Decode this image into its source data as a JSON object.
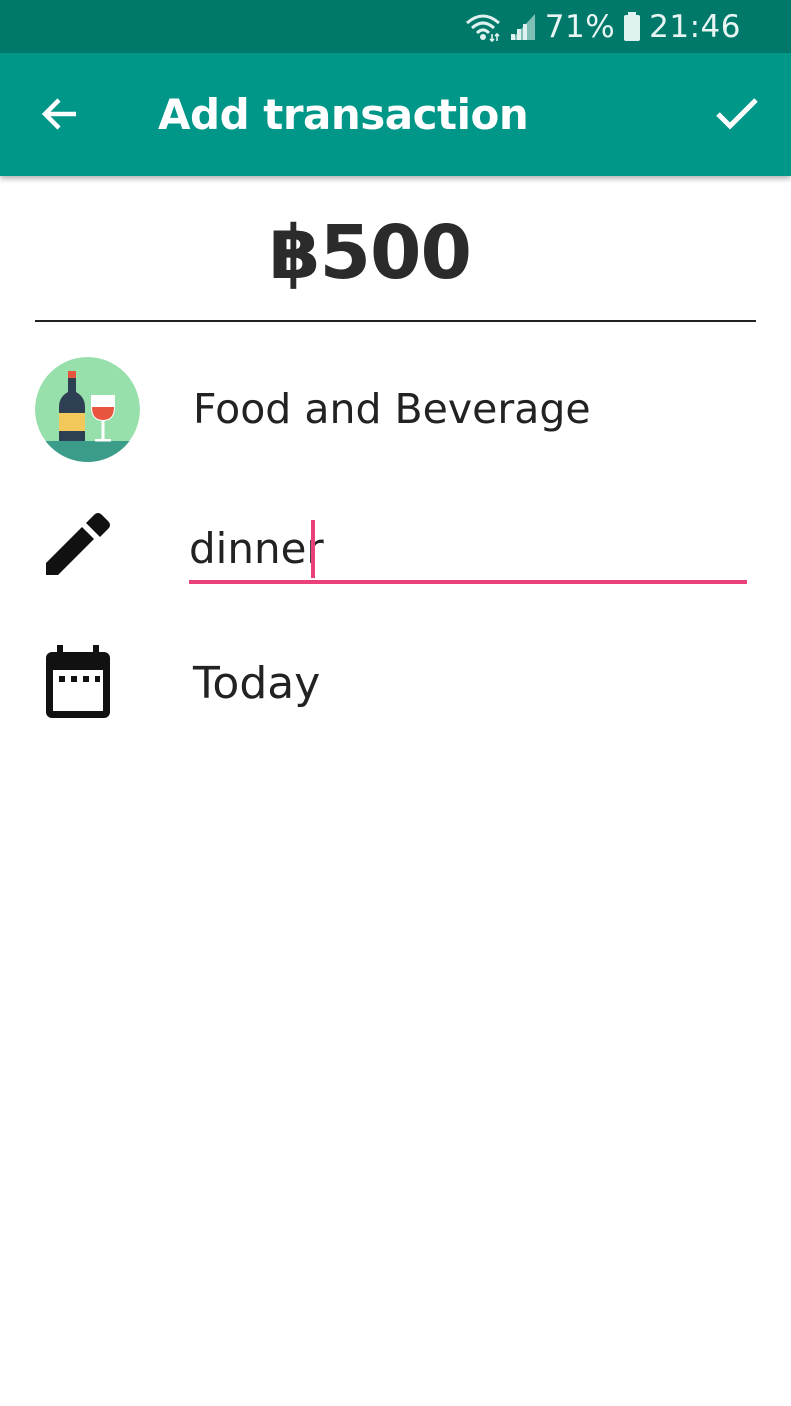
{
  "status_bar": {
    "battery_percent": "71%",
    "time": "21:46",
    "icons": [
      "wifi-icon",
      "signal-icon",
      "battery-icon"
    ]
  },
  "app_bar": {
    "title": "Add transaction",
    "back_icon": "arrow-back-icon",
    "save_icon": "check-icon",
    "color": "#009688",
    "status_color": "#00796b"
  },
  "transaction": {
    "amount": "฿500",
    "category": {
      "label": "Food and Beverage",
      "icon": "wine-bottle-glass-icon"
    },
    "note": {
      "value": "dinner",
      "icon": "pencil-icon",
      "accent_color": "#ec407a"
    },
    "date": {
      "label": "Today",
      "icon": "calendar-icon"
    }
  }
}
